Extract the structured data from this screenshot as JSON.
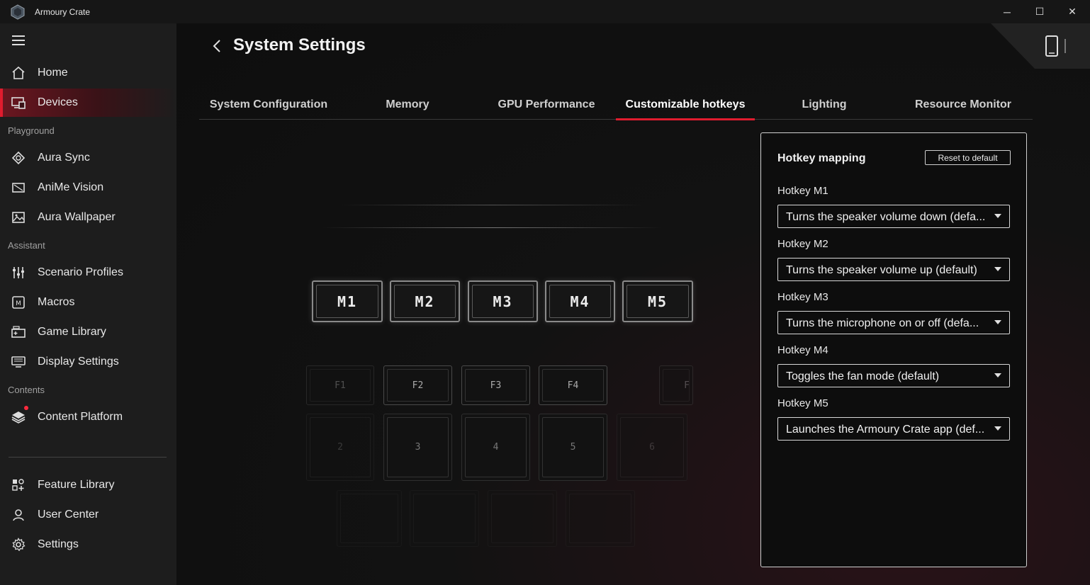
{
  "window": {
    "title": "Armoury Crate",
    "minimize": "─",
    "maximize": "☐",
    "close": "✕"
  },
  "sidebar": {
    "items_top": [
      {
        "label": "Home",
        "icon": "home-icon"
      },
      {
        "label": "Devices",
        "icon": "devices-icon",
        "active": true
      }
    ],
    "section_playground": "Playground",
    "items_playground": [
      {
        "label": "Aura Sync",
        "icon": "aura-sync-icon"
      },
      {
        "label": "AniMe Vision",
        "icon": "anime-vision-icon"
      },
      {
        "label": "Aura Wallpaper",
        "icon": "wallpaper-icon"
      }
    ],
    "section_assistant": "Assistant",
    "items_assistant": [
      {
        "label": "Scenario Profiles",
        "icon": "sliders-icon"
      },
      {
        "label": "Macros",
        "icon": "macro-icon"
      },
      {
        "label": "Game Library",
        "icon": "game-library-icon"
      },
      {
        "label": "Display Settings",
        "icon": "display-icon"
      }
    ],
    "section_contents": "Contents",
    "items_contents": [
      {
        "label": "Content Platform",
        "icon": "layers-icon"
      }
    ],
    "items_bottom": [
      {
        "label": "Feature Library",
        "icon": "feature-library-icon"
      },
      {
        "label": "User Center",
        "icon": "user-icon"
      },
      {
        "label": "Settings",
        "icon": "gear-icon"
      }
    ]
  },
  "page": {
    "title": "System Settings"
  },
  "tabs": [
    {
      "label": "System Configuration"
    },
    {
      "label": "Memory"
    },
    {
      "label": "GPU Performance"
    },
    {
      "label": "Customizable hotkeys",
      "active": true
    },
    {
      "label": "Lighting"
    },
    {
      "label": "Resource Monitor"
    }
  ],
  "keyboard": {
    "macro_keys": [
      "M1",
      "M2",
      "M3",
      "M4",
      "M5"
    ],
    "function_keys": [
      "F1",
      "F2",
      "F3",
      "F4",
      "F"
    ],
    "number_keys": [
      "2",
      "3",
      "4",
      "5",
      "6"
    ]
  },
  "hotkey_panel": {
    "title": "Hotkey mapping",
    "reset_label": "Reset to default",
    "hotkeys": [
      {
        "label": "Hotkey M1",
        "value": "Turns the speaker volume down (defa..."
      },
      {
        "label": "Hotkey M2",
        "value": "Turns the speaker volume up (default)"
      },
      {
        "label": "Hotkey M3",
        "value": "Turns the microphone on or off (defa..."
      },
      {
        "label": "Hotkey M4",
        "value": "Toggles the fan mode (default)"
      },
      {
        "label": "Hotkey M5",
        "value": "Launches the Armoury Crate app (def..."
      }
    ]
  },
  "colors": {
    "accent": "#e01c2e",
    "sidebar_bg": "#1d1d1d",
    "main_bg": "#0e0e0e"
  }
}
